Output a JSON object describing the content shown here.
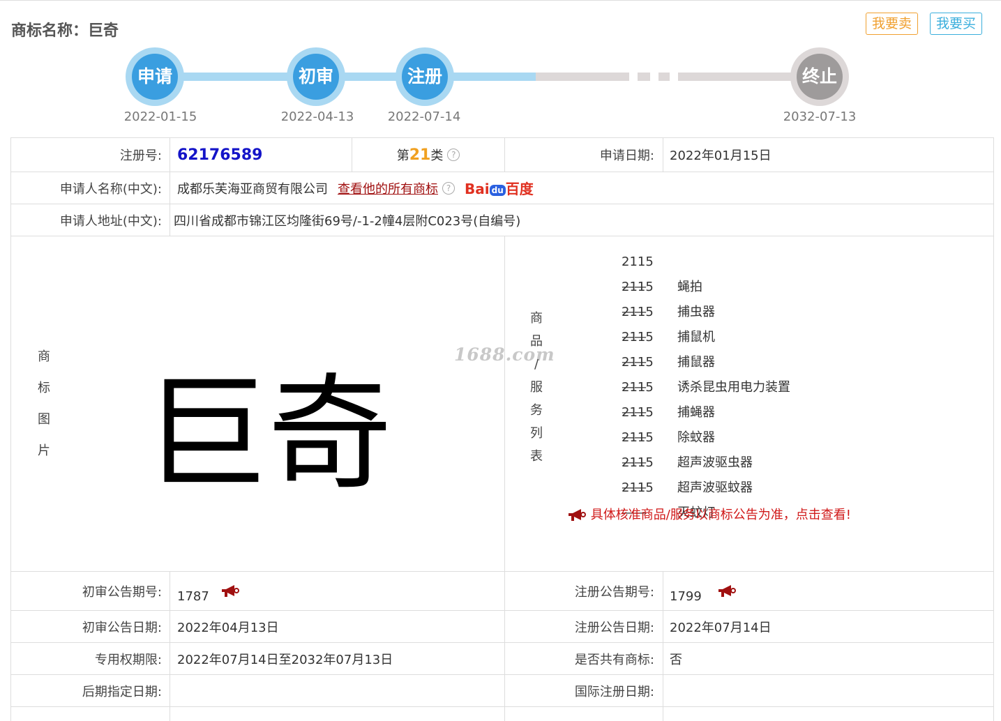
{
  "header": {
    "title": "商标名称：巨奇",
    "sell_button": "我要卖",
    "buy_button": "我要买"
  },
  "timeline": {
    "steps": [
      {
        "label": "申请",
        "date": "2022-01-15",
        "state": "done"
      },
      {
        "label": "初审",
        "date": "2022-04-13",
        "state": "done"
      },
      {
        "label": "注册",
        "date": "2022-07-14",
        "state": "done"
      },
      {
        "label": "终止",
        "date": "2032-07-13",
        "state": "future"
      }
    ],
    "colors": {
      "done": "#3a9ee0",
      "future": "#9e9b9b"
    }
  },
  "details": {
    "reg_no_label": "注册号:",
    "reg_no": "62176589",
    "class_prefix": "第",
    "class_num": "21",
    "class_suffix": "类",
    "apply_date_label": "申请日期:",
    "apply_date": "2022年01月15日",
    "applicant_label": "申请人名称(中文):",
    "applicant": "成都乐芙海亚商贸有限公司",
    "all_marks_link": "查看他的所有商标",
    "baidu_text_a": "Bai",
    "baidu_text_du": "du",
    "baidu_text_b": "百度",
    "address_label": "申请人地址(中文):",
    "address": "四川省成都市锦江区均隆街69号/-1-2幢4层附C023号(自编号)",
    "mark_image_label": [
      "商",
      "标",
      "图",
      "片"
    ],
    "mark_text": "巨奇",
    "watermark": "1688.com",
    "goods_label": [
      "商",
      "品",
      "/",
      "服",
      "务",
      "列",
      "表"
    ],
    "goods": [
      {
        "code": "2115——",
        "name": "蝇拍"
      },
      {
        "code": "2115——",
        "name": "捕虫器"
      },
      {
        "code": "2115——",
        "name": "捕鼠机"
      },
      {
        "code": "2115——",
        "name": "捕鼠器"
      },
      {
        "code": "2115——",
        "name": "诱杀昆虫用电力装置"
      },
      {
        "code": "2115——",
        "name": "捕蝇器"
      },
      {
        "code": "2115——",
        "name": "除蚊器"
      },
      {
        "code": "2115——",
        "name": "超声波驱虫器"
      },
      {
        "code": "2115——",
        "name": "超声波驱蚊器"
      },
      {
        "code": "2115——",
        "name": "灭蚊灯"
      }
    ],
    "goods_notice": "具体核准商品/服务以商标公告为准，点击查看!",
    "prelim_no_label": "初审公告期号:",
    "prelim_no": "1787",
    "reg_pub_no_label": "注册公告期号:",
    "reg_pub_no": "1799",
    "prelim_date_label": "初审公告日期:",
    "prelim_date": "2022年04月13日",
    "reg_pub_date_label": "注册公告日期:",
    "reg_pub_date": "2022年07月14日",
    "exclusive_label": "专用权期限:",
    "exclusive": "2022年07月14日至2032年07月13日",
    "shared_label": "是否共有商标:",
    "shared": "否",
    "later_label": "后期指定日期:",
    "later": "",
    "intl_label": "国际注册日期:",
    "intl": ""
  }
}
